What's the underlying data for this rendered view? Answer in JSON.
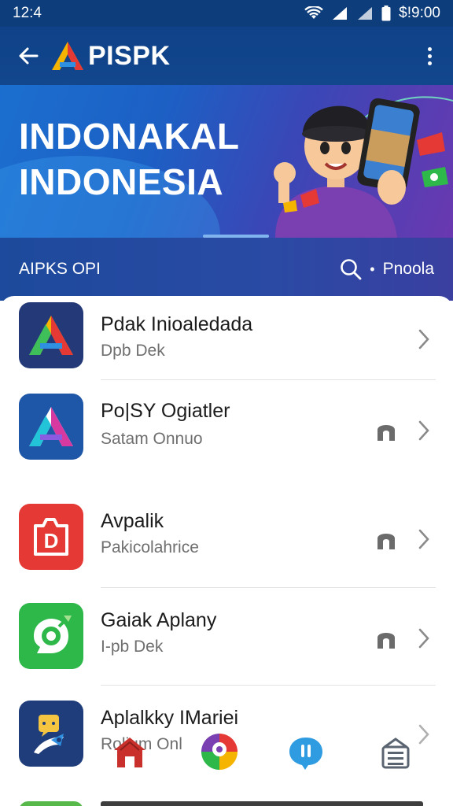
{
  "status_bar": {
    "time": "12:4",
    "status_text": "$!9:00"
  },
  "app_bar": {
    "title": "PISPK"
  },
  "banner": {
    "line1": "INDONAKAL",
    "line2": "INDONESIA"
  },
  "subbar": {
    "label": "AIPKS OPI",
    "search_text": "Pnoola"
  },
  "apps": [
    {
      "title": "Pdak Inioaledada",
      "subtitle": "Dpb Dek",
      "badge": false
    },
    {
      "title": "Po|SY Ogiatler",
      "subtitle": "Satam Onnuo",
      "badge": true
    },
    {
      "title": "Avpalik",
      "subtitle": "Pakicolahrice",
      "badge": true
    },
    {
      "title": "Gaiak Aplany",
      "subtitle": "I-pb Dek",
      "badge": true
    },
    {
      "title": "Aplalkky IMariei",
      "subtitle": "Rolium Onl",
      "badge": true
    }
  ],
  "colors": {
    "primary": "#0f4288",
    "accent_red": "#e53935",
    "accent_green": "#2eb84a",
    "text_primary": "#1c1c1c",
    "text_secondary": "#6f6f6f"
  },
  "icons": {
    "nav": [
      "home-icon",
      "maps-icon",
      "chat-icon",
      "store-icon"
    ]
  }
}
